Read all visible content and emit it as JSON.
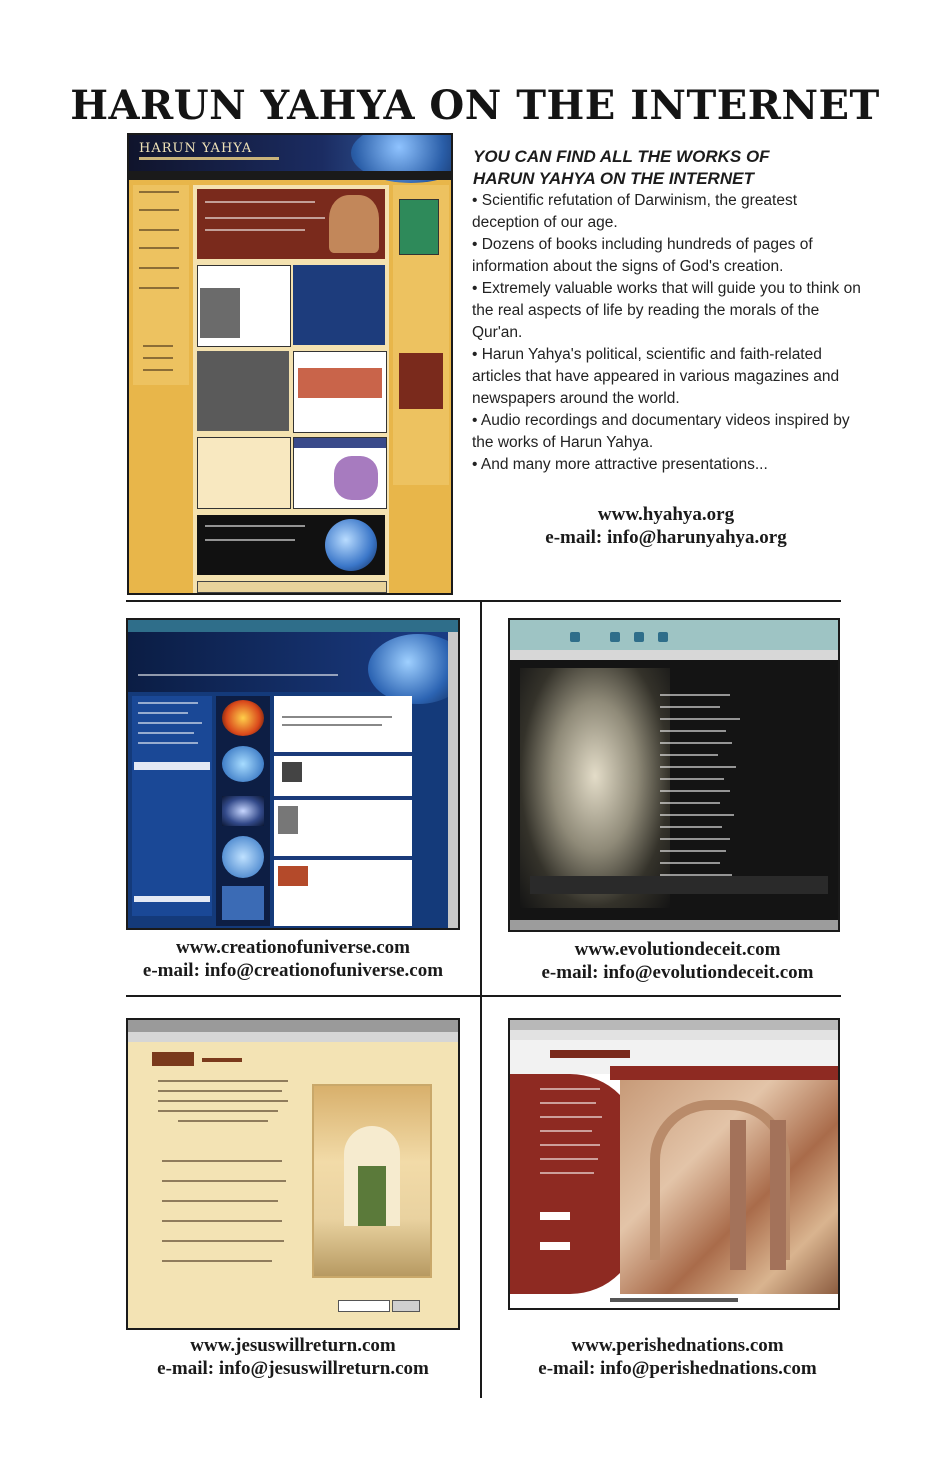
{
  "page": {
    "title": "HARUN YAHYA ON THE INTERNET"
  },
  "intro": {
    "heading_line1": "YOU CAN FIND ALL THE WORKS OF",
    "heading_line2": "HARUN YAHYA ON THE INTERNET",
    "bullets": [
      "• Scientific refutation of Darwinism, the greatest deception of our age.",
      "• Dozens of books including hundreds of pages of information about the signs of God's creation.",
      "• Extremely valuable works that will guide you to think on the real aspects of life by reading the morals of the Qur'an.",
      "• Harun Yahya's political, scientific and faith-related articles that have appeared in various magazines and newspapers around the world.",
      "• Audio recordings and documentary videos inspired by the works of Harun Yahya.",
      "• And many more attractive presentations..."
    ],
    "url": "www.hyahya.org",
    "email": "e-mail: info@harunyahya.org"
  },
  "hyahya_shot": {
    "logo": "HARUN YAHYA"
  },
  "sites": [
    {
      "url": "www.creationofuniverse.com",
      "email": "e-mail: info@creationofuniverse.com"
    },
    {
      "url": "www.evolutiondeceit.com",
      "email": "e-mail: info@evolutiondeceit.com"
    },
    {
      "url": "www.jesuswillreturn.com",
      "email": "e-mail: info@jesuswillreturn.com"
    },
    {
      "url": "www.perishednations.com",
      "email": "e-mail: info@perishednations.com"
    }
  ],
  "colors": {
    "hyahya_bg": "#e8b64a",
    "creation_bg": "#143a7a",
    "evolution_bg": "#141414",
    "jesus_bg": "#f3e3b4",
    "perished_bg": "#8e2a22"
  }
}
